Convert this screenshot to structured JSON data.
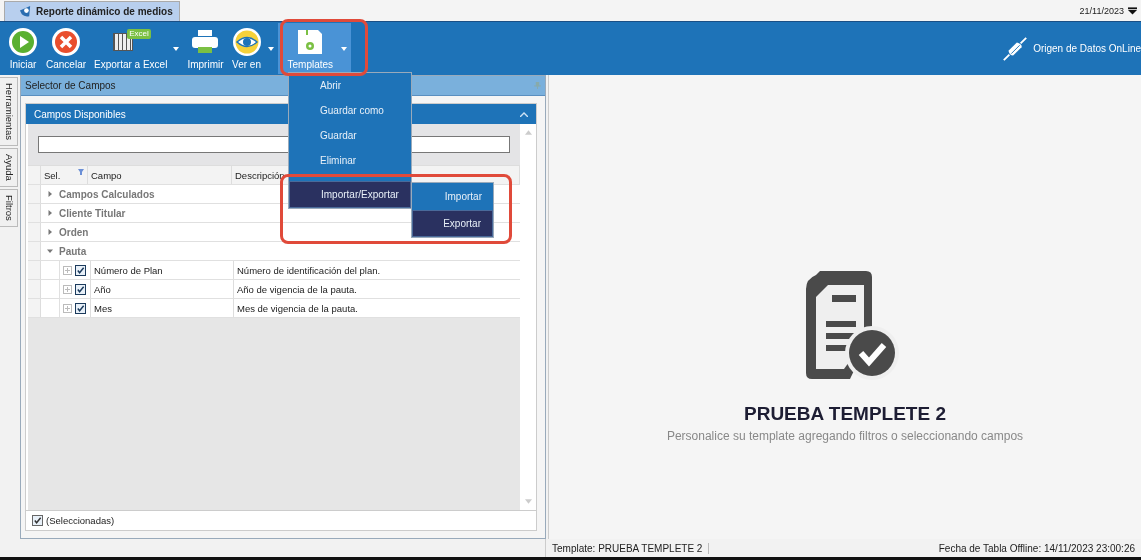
{
  "document_tab": {
    "title": "Reporte dinámico de medios",
    "selected": true
  },
  "date": "21/11/2023",
  "toolbar": [
    {
      "kind": "play",
      "label": "Iniciar",
      "selected": false
    },
    {
      "kind": "cancel",
      "label": "Cancelar",
      "selected": false
    },
    {
      "kind": "excel",
      "label": "Exportar a Excel",
      "badge": "Excel",
      "dropdown": true,
      "selected": false
    },
    {
      "kind": "print",
      "label": "Imprimir",
      "selected": false
    },
    {
      "kind": "eye",
      "label": "Ver en",
      "dropdown": true,
      "selected": false
    },
    {
      "kind": "save",
      "label": "Templates",
      "dropdown": true,
      "selected": true
    }
  ],
  "data_source": "Origen de Datos OnLine",
  "side_tabs": [
    "Herramientas",
    "Ayuda",
    "Filtros"
  ],
  "panel": {
    "title": "Selector de Campos",
    "group": {
      "title": "Campos Disponibles",
      "expanded": true,
      "columns": [
        "Sel.",
        "Campo",
        "Descripción"
      ],
      "tree": [
        {
          "label": "Campos Calculados",
          "expanded": false
        },
        {
          "label": "Cliente Titular",
          "expanded": false
        },
        {
          "label": "Orden",
          "expanded": false
        },
        {
          "label": "Pauta",
          "expanded": true,
          "children": [
            {
              "checked": true,
              "campo": "Número de Plan",
              "descripcion": "Número de identificación del plan."
            },
            {
              "checked": true,
              "campo": "Año",
              "descripcion": "Año de vigencia de la pauta."
            },
            {
              "checked": true,
              "campo": "Mes",
              "descripcion": "Mes de vigencia de la pauta."
            }
          ]
        }
      ],
      "filter": {
        "checked": true,
        "label": "(Seleccionadas)"
      }
    }
  },
  "menu": [
    {
      "label": "Abrir",
      "selected": false
    },
    {
      "label": "Guardar como",
      "selected": false
    },
    {
      "label": "Guardar",
      "selected": false
    },
    {
      "label": "Eliminar",
      "selected": false
    },
    {
      "label": "Importar/Exportar",
      "selected": true
    }
  ],
  "submenu": [
    {
      "label": "Importar",
      "selected": false
    },
    {
      "label": "Exportar",
      "selected": true
    }
  ],
  "preview": {
    "title": "PRUEBA TEMPLETE 2",
    "subtitle": "Personalice su template agregando filtros o seleccionando campos"
  },
  "status_bar": {
    "template": "Template: PRUEBA TEMPLETE 2",
    "offline_date": "Fecha de Tabla Offline: 14/11/2023 23:00:26"
  }
}
